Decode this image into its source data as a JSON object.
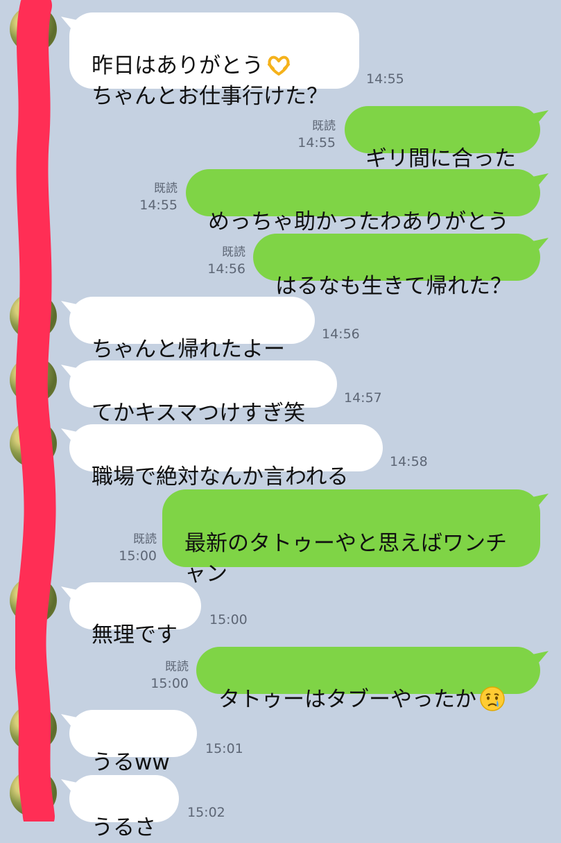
{
  "messages": [
    {
      "dir": "in",
      "text": "昨日はありがとう",
      "emoji": "heart-hands",
      "line2": "ちゃんとお仕事行けた？",
      "time": "14:55"
    },
    {
      "dir": "out",
      "text": "ギリ間に合った",
      "read": "既読",
      "time": "14:55"
    },
    {
      "dir": "out",
      "text": "めっちゃ助かったわありがとう",
      "read": "既読",
      "time": "14:55"
    },
    {
      "dir": "out",
      "text": "はるなも生きて帰れた？",
      "read": "既読",
      "time": "14:56"
    },
    {
      "dir": "in",
      "text": "ちゃんと帰れたよー",
      "time": "14:56"
    },
    {
      "dir": "in",
      "text": "てかキスマつけすぎ笑",
      "time": "14:57"
    },
    {
      "dir": "in",
      "text": "職場で絶対なんか言われる",
      "time": "14:58"
    },
    {
      "dir": "out",
      "text": "最新のタトゥーやと思えばワンチャン",
      "read": "既読",
      "time": "15:00"
    },
    {
      "dir": "in",
      "text": "無理です",
      "time": "15:00"
    },
    {
      "dir": "out",
      "text": "タトゥーはタブーやったか",
      "emoji": "crying-face",
      "read": "既読",
      "time": "15:00"
    },
    {
      "dir": "in",
      "text": "うるww",
      "time": "15:01"
    },
    {
      "dir": "in",
      "text": "うるさ",
      "time": "15:02"
    }
  ],
  "colors": {
    "background": "#c5d1e1",
    "incoming_bubble": "#ffffff",
    "outgoing_bubble": "#7fd446",
    "redaction": "#ff2e55",
    "meta_text": "#5d6675"
  }
}
